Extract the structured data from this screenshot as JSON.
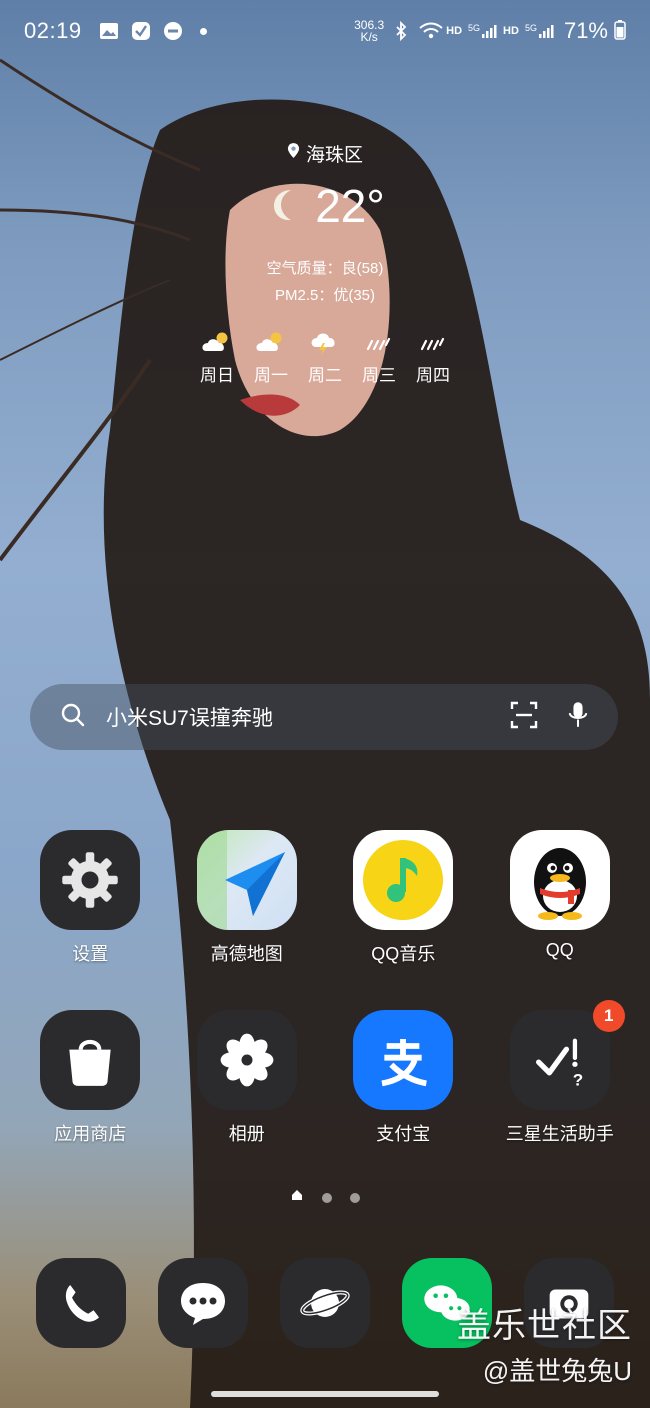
{
  "status_bar": {
    "time": "02:19",
    "net_speed_value": "306.3",
    "net_speed_unit": "K/s",
    "hd1": "HD",
    "sim1": "5G",
    "hd2": "HD",
    "sim2": "5G",
    "battery": "71%",
    "icons": [
      "gallery-icon",
      "check-icon",
      "dnd-icon",
      "dot-icon",
      "bluetooth-icon",
      "wifi-icon",
      "signal-icon",
      "battery-icon"
    ]
  },
  "weather": {
    "location": "海珠区",
    "temperature": "22°",
    "air_quality": "空气质量：良(58)",
    "pm25": "PM2.5：优(35)",
    "forecast": [
      {
        "day": "周日",
        "icon": "cloud-sun-icon"
      },
      {
        "day": "周一",
        "icon": "cloud-sun-icon"
      },
      {
        "day": "周二",
        "icon": "thunder-icon"
      },
      {
        "day": "周三",
        "icon": "rain-icon"
      },
      {
        "day": "周四",
        "icon": "rain-icon"
      }
    ]
  },
  "search": {
    "text": "小米SU7误撞奔驰"
  },
  "apps": {
    "row1": [
      {
        "label": "设置",
        "icon": "settings-icon"
      },
      {
        "label": "高德地图",
        "icon": "amap-icon"
      },
      {
        "label": "QQ音乐",
        "icon": "qqmusic-icon"
      },
      {
        "label": "QQ",
        "icon": "qq-icon"
      }
    ],
    "row2": [
      {
        "label": "应用商店",
        "icon": "store-icon"
      },
      {
        "label": "相册",
        "icon": "gallery-app-icon"
      },
      {
        "label": "支付宝",
        "icon": "alipay-icon"
      },
      {
        "label": "三星生活助手",
        "icon": "samsung-assistant-icon",
        "badge": "1"
      }
    ]
  },
  "dock": [
    "phone-icon",
    "messages-icon",
    "browser-icon",
    "wechat-icon",
    "camera-icon"
  ],
  "watermark": {
    "title": "盖乐世社区",
    "user": "@盖世兔兔U"
  },
  "colors": {
    "badge": "#f04a2a",
    "alipay": "#1677ff",
    "wechat": "#07c160",
    "qqmusic_yellow": "#f7d416"
  }
}
